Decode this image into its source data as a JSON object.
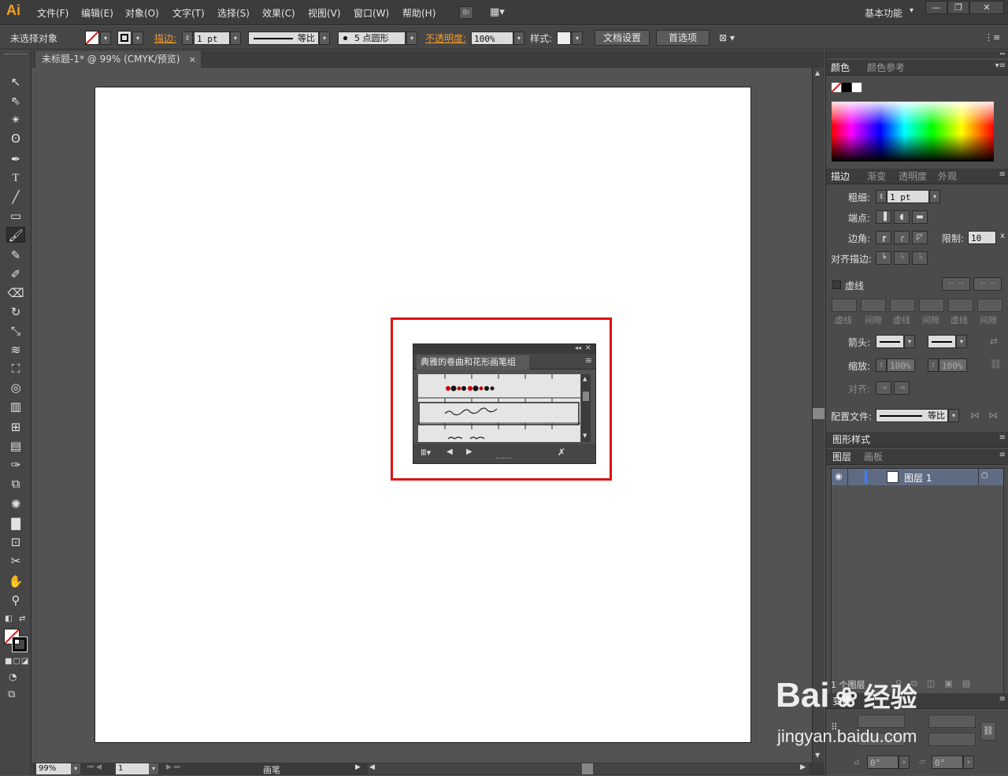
{
  "app": {
    "logo": "Ai"
  },
  "menu": [
    "文件(F)",
    "编辑(E)",
    "对象(O)",
    "文字(T)",
    "选择(S)",
    "效果(C)",
    "视图(V)",
    "窗口(W)",
    "帮助(H)"
  ],
  "menubar_right": {
    "bridge_label": "Br",
    "workspace": "基本功能",
    "workspace_arrow": "▾"
  },
  "window_controls": {
    "minimize": "—",
    "restore": "❐",
    "close": "✕"
  },
  "control_bar": {
    "selection_status": "未选择对象",
    "stroke_label": "描边:",
    "stroke_weight": "1 pt",
    "profile": "等比",
    "brush_def": "5 点圆形",
    "opacity_label": "不透明度:",
    "opacity_value": "100%",
    "style_label": "样式:",
    "doc_setup_button": "文档设置",
    "prefs_button": "首选项"
  },
  "document": {
    "tab_title": "未标题-1* @ 99% (CMYK/预览)",
    "tab_close": "×"
  },
  "status_bar": {
    "zoom": "99%",
    "artboard_num": "1",
    "tool_name": "画笔"
  },
  "color_panel": {
    "tabs": [
      "颜色",
      "颜色参考"
    ]
  },
  "stroke_panel": {
    "tabs": [
      "描边",
      "渐变",
      "透明度",
      "外观"
    ],
    "weight_label": "粗细:",
    "weight_value": "1 pt",
    "cap_label": "端点:",
    "corner_label": "边角:",
    "limit_label": "限制:",
    "limit_value": "10",
    "limit_unit": "x",
    "align_label": "对齐描边:",
    "dashed_label": "虚线",
    "dash_labels": [
      "虚线",
      "间隙",
      "虚线",
      "间隙",
      "虚线",
      "间隙"
    ],
    "arrow_label": "箭头:",
    "scale_label": "缩放:",
    "scale_start": "100%",
    "scale_end": "100%",
    "align_arrow_label": "对齐:",
    "profile_label": "配置文件:",
    "profile_value": "等比"
  },
  "graphic_styles_panel": {
    "tabs": [
      "图形样式"
    ]
  },
  "layers_panel": {
    "tabs": [
      "图层",
      "画板"
    ],
    "layer_name": "图层 1",
    "footer_count": "1 个图层"
  },
  "transform_panel": {
    "tab": "变换",
    "rotate_value": "0°",
    "shear_value": "0°"
  },
  "brush_panel": {
    "title": "典雅的卷曲和花形画笔组",
    "collapse_icon": "◂◂",
    "close_icon": "×",
    "menu_icon": "≡"
  },
  "watermark": {
    "brand": "Bai",
    "brand2": "经验",
    "url": "jingyan.baidu.com"
  },
  "colors": {
    "highlight_box": "#e01010",
    "accent_orange": "#f29b32",
    "layer_row": "#5e6b82",
    "logo": "#f7a21b"
  }
}
